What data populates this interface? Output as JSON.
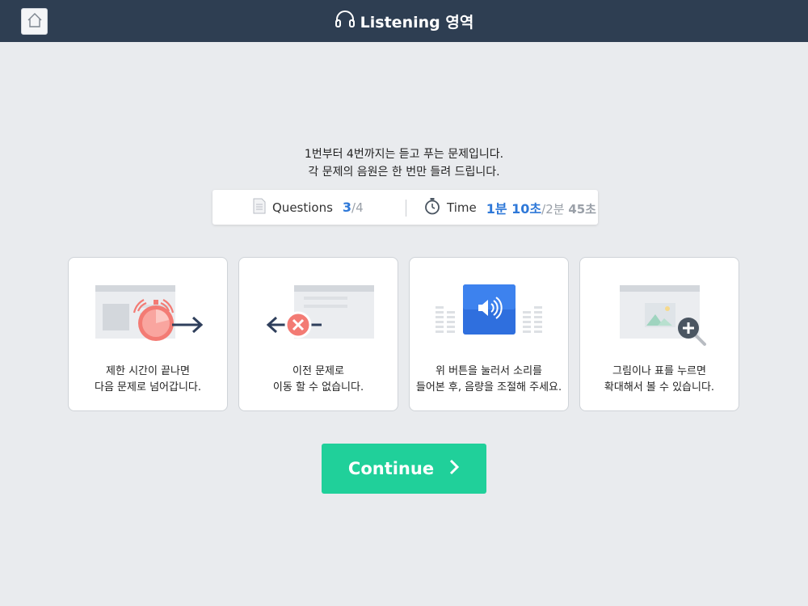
{
  "header": {
    "title": "Listening 영역",
    "home_icon": "home-icon",
    "headphones_icon": "headphones-icon"
  },
  "instructions": {
    "line1": "1번부터 4번까지는 듣고 푸는 문제입니다.",
    "line2": "각 문제의 음원은 한 번만 들려 드립니다."
  },
  "stats": {
    "questions_label": "Questions",
    "questions_current": "3",
    "questions_total": "/4",
    "time_label": "Time",
    "time_elapsed": "1분 10초",
    "time_limit_sep": "/2분 ",
    "time_limit_rest": "45초"
  },
  "cards": [
    {
      "line1": "제한 시간이 끝나면",
      "line2": "다음 문제로 넘어갑니다.",
      "icon": "timer-next-icon"
    },
    {
      "line1": "이전 문제로",
      "line2": "이동 할 수 없습니다.",
      "icon": "no-back-icon"
    },
    {
      "line1": "위 버튼을 눌러서 소리를",
      "line2": "들어본 후, 음량을 조절해 주세요.",
      "icon": "speaker-icon"
    },
    {
      "line1": "그림이나 표를 누르면",
      "line2": "확대해서 볼 수 있습니다.",
      "icon": "zoom-image-icon"
    }
  ],
  "continue_button": {
    "label": "Continue",
    "icon": "chevron-right-icon"
  },
  "colors": {
    "topbar": "#2e3e52",
    "accent_blue": "#2e78d8",
    "continue_green": "#20d09a",
    "alarm_red": "#f37b74"
  }
}
